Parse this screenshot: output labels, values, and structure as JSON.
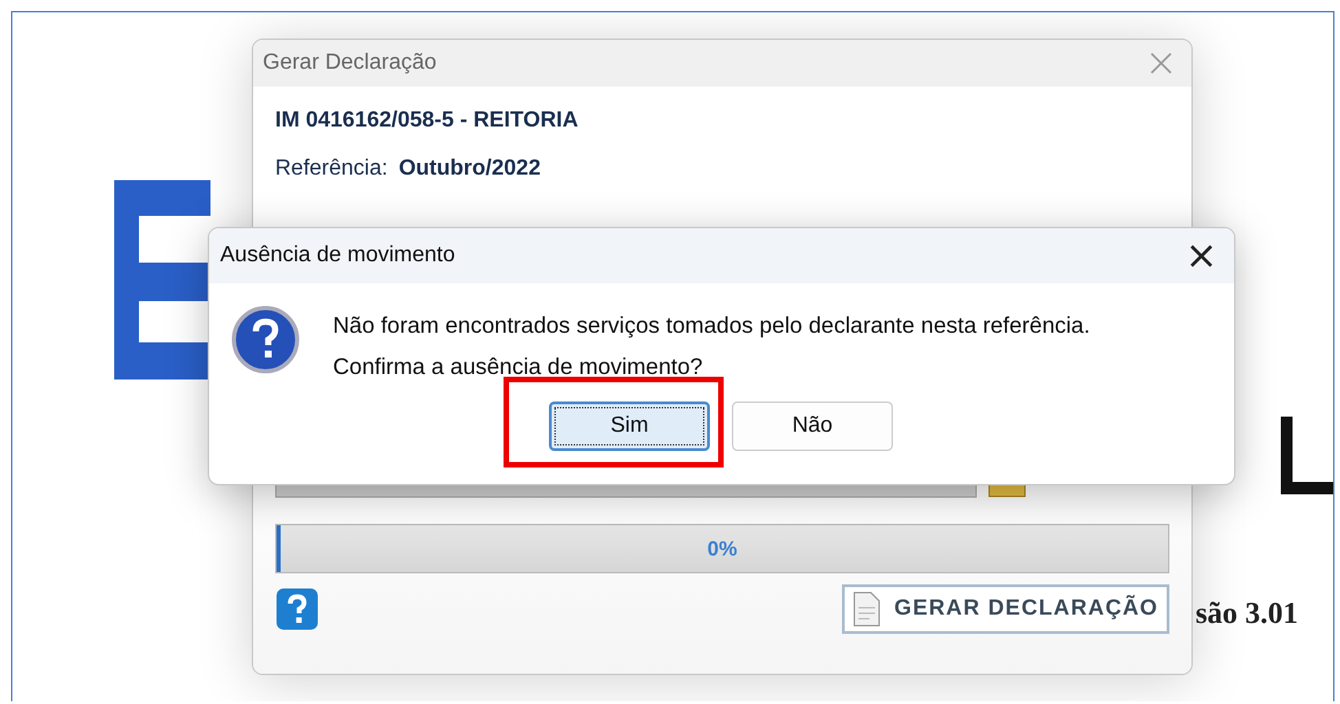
{
  "background": {
    "version_text": "são 3.01"
  },
  "main_window": {
    "title": "Gerar Declaração",
    "heading": "IM 0416162/058-5 - REITORIA",
    "reference_label": "Referência:",
    "reference_value": "Outubro/2022",
    "progress": {
      "level": 0,
      "reading": "0%"
    },
    "generate_button": "GERAR DECLARAÇÃO"
  },
  "dialog": {
    "title": "Ausência de movimento",
    "close": "×",
    "message": [
      "Não foram encontrados serviços tomados pelo declarante nesta referência.",
      "Confirma a ausência de movimento?"
    ],
    "buttons": [
      {
        "label": "Sim",
        "selected": true,
        "highlighted": true
      },
      {
        "label": "Não",
        "selected": false,
        "highlighted": false
      }
    ]
  }
}
